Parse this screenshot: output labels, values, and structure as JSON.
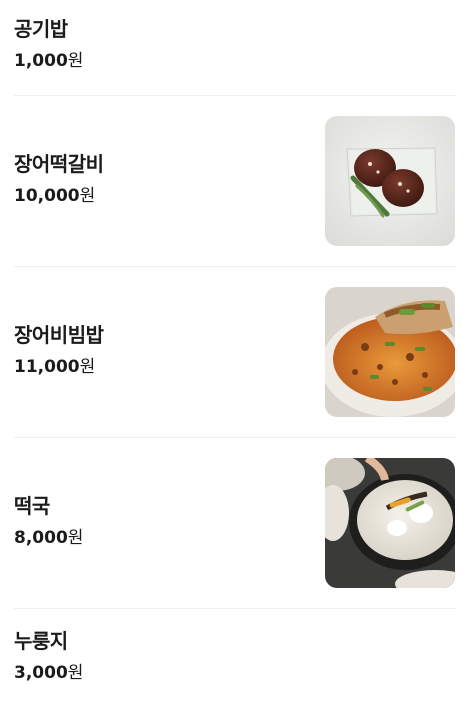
{
  "menu": {
    "items": [
      {
        "name": "공기밥",
        "price": "1,000",
        "currency": "원",
        "has_image": false
      },
      {
        "name": "장어떡갈비",
        "price": "10,000",
        "currency": "원",
        "has_image": true,
        "image": "grilled-eel-patties-photo"
      },
      {
        "name": "장어비빔밥",
        "price": "11,000",
        "currency": "원",
        "has_image": true,
        "image": "eel-bibimbap-photo"
      },
      {
        "name": "떡국",
        "price": "8,000",
        "currency": "원",
        "has_image": true,
        "image": "rice-cake-soup-photo"
      },
      {
        "name": "누룽지",
        "price": "3,000",
        "currency": "원",
        "has_image": false
      }
    ]
  }
}
